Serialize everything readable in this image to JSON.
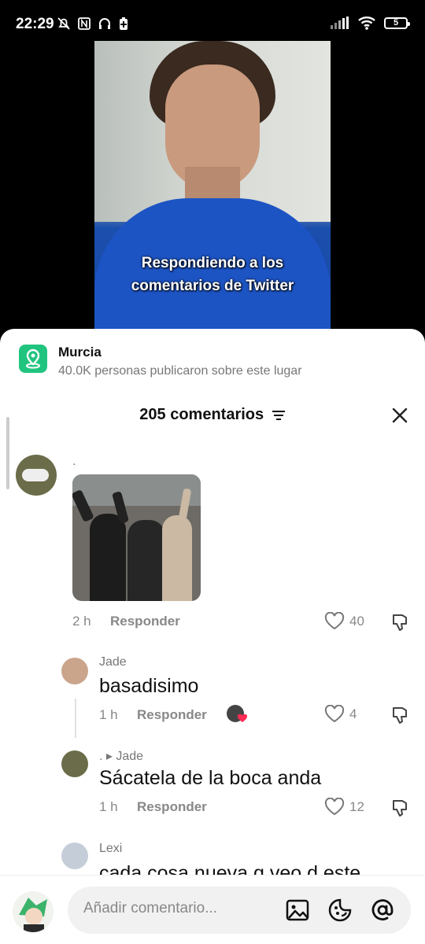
{
  "status_bar": {
    "time": "22:29",
    "battery": "5"
  },
  "video": {
    "caption_line1": "Respondiendo a los",
    "caption_line2": "comentarios de Twitter"
  },
  "location": {
    "name": "Murcia",
    "subtitle": "40.0K personas publicaron sobre este lugar",
    "icon": "map-pin-icon",
    "accent": "#21c47f"
  },
  "comments": {
    "header": "205 comentarios",
    "items": [
      {
        "user": ".",
        "time": "2 h",
        "reply_label": "Responder",
        "likes": "40"
      },
      {
        "user": "Jade",
        "text": "basadisimo",
        "time": "1 h",
        "reply_label": "Responder",
        "likes": "4"
      },
      {
        "user": ". ▸ Jade",
        "text": "Sácatela de la boca anda",
        "time": "1 h",
        "reply_label": "Responder",
        "likes": "12"
      },
      {
        "user": "Lexi",
        "text": "cada cosa nueva q veo d este"
      }
    ]
  },
  "composer": {
    "placeholder": "Añadir comentario..."
  }
}
